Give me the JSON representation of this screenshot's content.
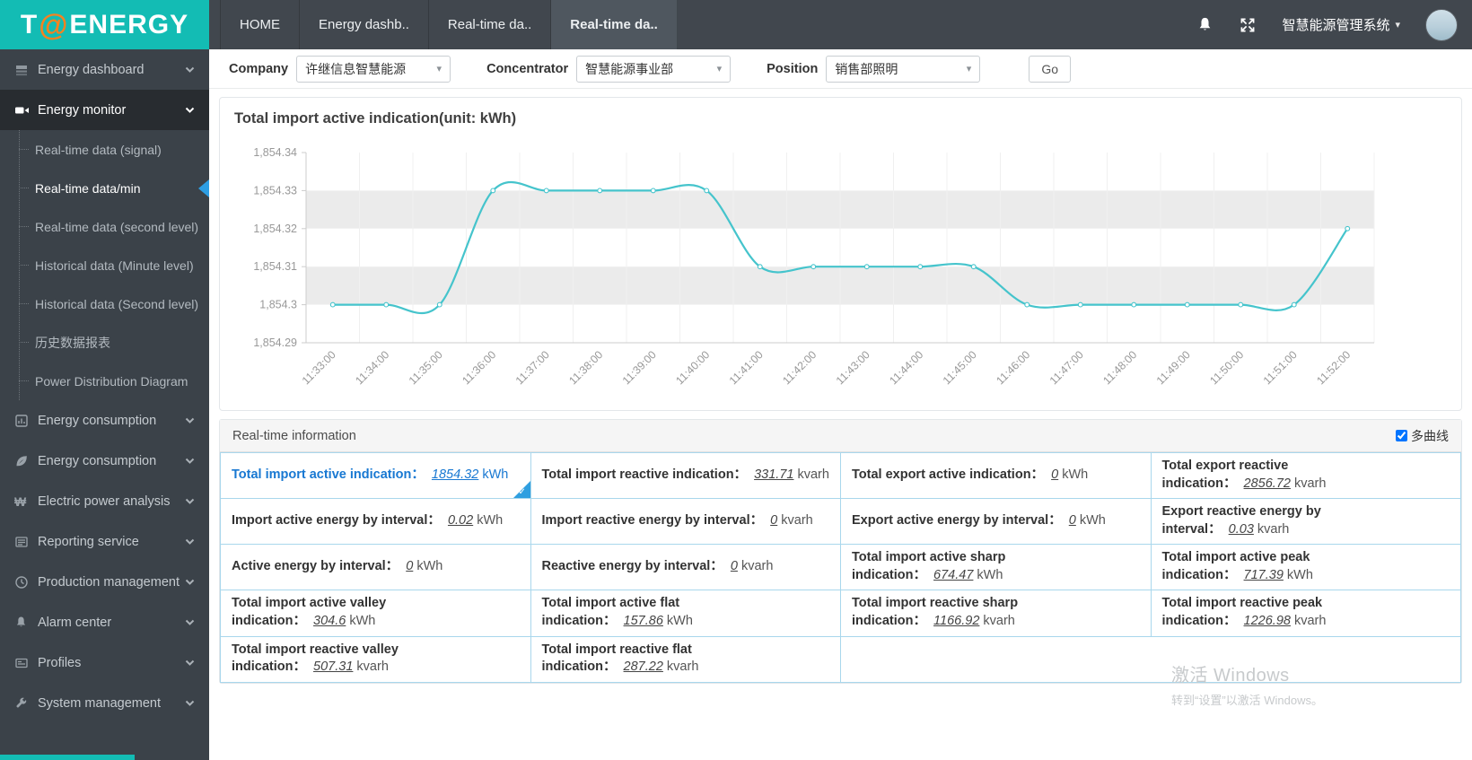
{
  "header": {
    "logo_t": "T",
    "logo_at": "@",
    "logo_rest": "ENERGY",
    "tabs": [
      {
        "label": "HOME",
        "active": false
      },
      {
        "label": "Energy dashb..",
        "active": false
      },
      {
        "label": "Real-time da..",
        "active": false
      },
      {
        "label": "Real-time da..",
        "active": true
      }
    ],
    "system_title": "智慧能源管理系统",
    "caret": "▾"
  },
  "sidebar": {
    "items": [
      {
        "label": "Energy dashboard"
      },
      {
        "label": "Energy monitor"
      },
      {
        "label": "Energy consumption"
      },
      {
        "label": "Energy consumption"
      },
      {
        "label": "Electric power analysis"
      },
      {
        "label": "Reporting service"
      },
      {
        "label": "Production management"
      },
      {
        "label": "Alarm center"
      },
      {
        "label": "Profiles"
      },
      {
        "label": "System management"
      }
    ],
    "submenu": [
      "Real-time data (signal)",
      "Real-time data/min",
      "Real-time data (second level)",
      "Historical data (Minute level)",
      "Historical data (Second level)",
      "历史数据报表",
      "Power Distribution Diagram"
    ],
    "active_item": "Energy monitor",
    "active_submenu": "Real-time data/min"
  },
  "filters": {
    "company_label": "Company",
    "company_value": "许继信息智慧能源",
    "concentrator_label": "Concentrator",
    "concentrator_value": "智慧能源事业部",
    "position_label": "Position",
    "position_value": "销售部照明",
    "go_label": "Go",
    "caret": "▾"
  },
  "chart_data": {
    "type": "line",
    "title": "Total import active indication(unit:  kWh)",
    "x": [
      "11:33:00",
      "11:34:00",
      "11:35:00",
      "11:36:00",
      "11:37:00",
      "11:38:00",
      "11:39:00",
      "11:40:00",
      "11:41:00",
      "11:42:00",
      "11:43:00",
      "11:44:00",
      "11:45:00",
      "11:46:00",
      "11:47:00",
      "11:48:00",
      "11:49:00",
      "11:50:00",
      "11:51:00",
      "11:52:00"
    ],
    "series": [
      {
        "name": "Total import active indication",
        "values": [
          1854.3,
          1854.3,
          1854.3,
          1854.33,
          1854.33,
          1854.33,
          1854.33,
          1854.33,
          1854.31,
          1854.31,
          1854.31,
          1854.31,
          1854.31,
          1854.3,
          1854.3,
          1854.3,
          1854.3,
          1854.3,
          1854.3,
          1854.32
        ]
      }
    ],
    "ylim": [
      1854.29,
      1854.34
    ],
    "yticks": {
      "values": [
        1854.29,
        1854.3,
        1854.31,
        1854.32,
        1854.33,
        1854.34
      ],
      "labels": [
        "1,854.29",
        "1,854.3",
        "1,854.31",
        "1,854.32",
        "1,854.33",
        "1,854.34"
      ]
    },
    "line_color": "#45c4cc",
    "band_colors": [
      "#ffffff",
      "#ebebeb"
    ],
    "grid": true,
    "smooth": true,
    "legend_position": "none",
    "xlabel": "",
    "ylabel": ""
  },
  "info": {
    "panel_title": "Real-time information",
    "multi_curve_label": "多曲线",
    "multi_curve_checked": true
  },
  "info_table": {
    "rows": [
      [
        {
          "label": "Total import active indication：",
          "value": "1854.32",
          "unit": "kWh",
          "selected": true
        },
        {
          "label": "Total import reactive indication：",
          "value": "331.71",
          "unit": "kvarh"
        },
        {
          "label": "Total export active indication：",
          "value": "0",
          "unit": "kWh"
        },
        {
          "label": "Total export reactive indication：",
          "value": "2856.72",
          "unit": "kvarh"
        }
      ],
      [
        {
          "label": "Import active energy by interval：",
          "value": "0.02",
          "unit": "kWh"
        },
        {
          "label": "Import reactive energy by interval：",
          "value": "0",
          "unit": "kvarh"
        },
        {
          "label": "Export active energy by interval：",
          "value": "0",
          "unit": "kWh"
        },
        {
          "label": "Export reactive energy by interval：",
          "value": "0.03",
          "unit": "kvarh"
        }
      ],
      [
        {
          "label": "Active energy by interval：",
          "value": "0",
          "unit": "kWh"
        },
        {
          "label": "Reactive energy by interval：",
          "value": "0",
          "unit": "kvarh"
        },
        {
          "label": "Total import active sharp indication：",
          "value": "674.47",
          "unit": "kWh"
        },
        {
          "label": "Total import active peak indication：",
          "value": "717.39",
          "unit": "kWh"
        }
      ],
      [
        {
          "label": "Total import active valley indication：",
          "value": "304.6",
          "unit": "kWh"
        },
        {
          "label": "Total import active flat indication：",
          "value": "157.86",
          "unit": "kWh"
        },
        {
          "label": "Total import reactive sharp indication：",
          "value": "1166.92",
          "unit": "kvarh"
        },
        {
          "label": "Total import reactive peak indication：",
          "value": "1226.98",
          "unit": "kvarh"
        }
      ],
      [
        {
          "label": "Total import reactive valley indication：",
          "value": "507.31",
          "unit": "kvarh"
        },
        {
          "label": "Total import reactive flat indication：",
          "value": "287.22",
          "unit": "kvarh"
        },
        {
          "empty": true,
          "colspan": 2
        }
      ]
    ]
  },
  "watermark": {
    "line1": "激活 Windows",
    "line2": "转到“设置”以激活 Windows。"
  }
}
